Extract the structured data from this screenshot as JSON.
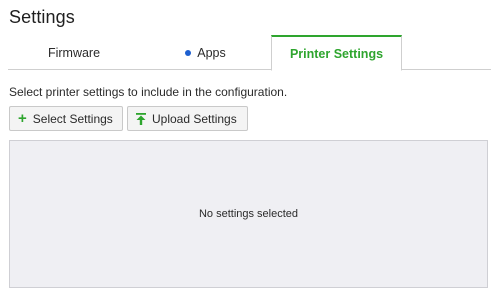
{
  "page": {
    "title": "Settings"
  },
  "tabs": [
    {
      "label": "Firmware"
    },
    {
      "label": "Apps",
      "indicator": "dot",
      "indicator_color": "#1d5fd0"
    },
    {
      "label": "Printer Settings",
      "active": true
    }
  ],
  "accent_color": "#2ea52e",
  "content": {
    "description": "Select printer settings to include in the configuration.",
    "buttons": {
      "select_label": "Select Settings",
      "select_icon": "plus-icon",
      "upload_label": "Upload Settings",
      "upload_icon": "upload-icon"
    },
    "empty_message": "No settings selected"
  }
}
